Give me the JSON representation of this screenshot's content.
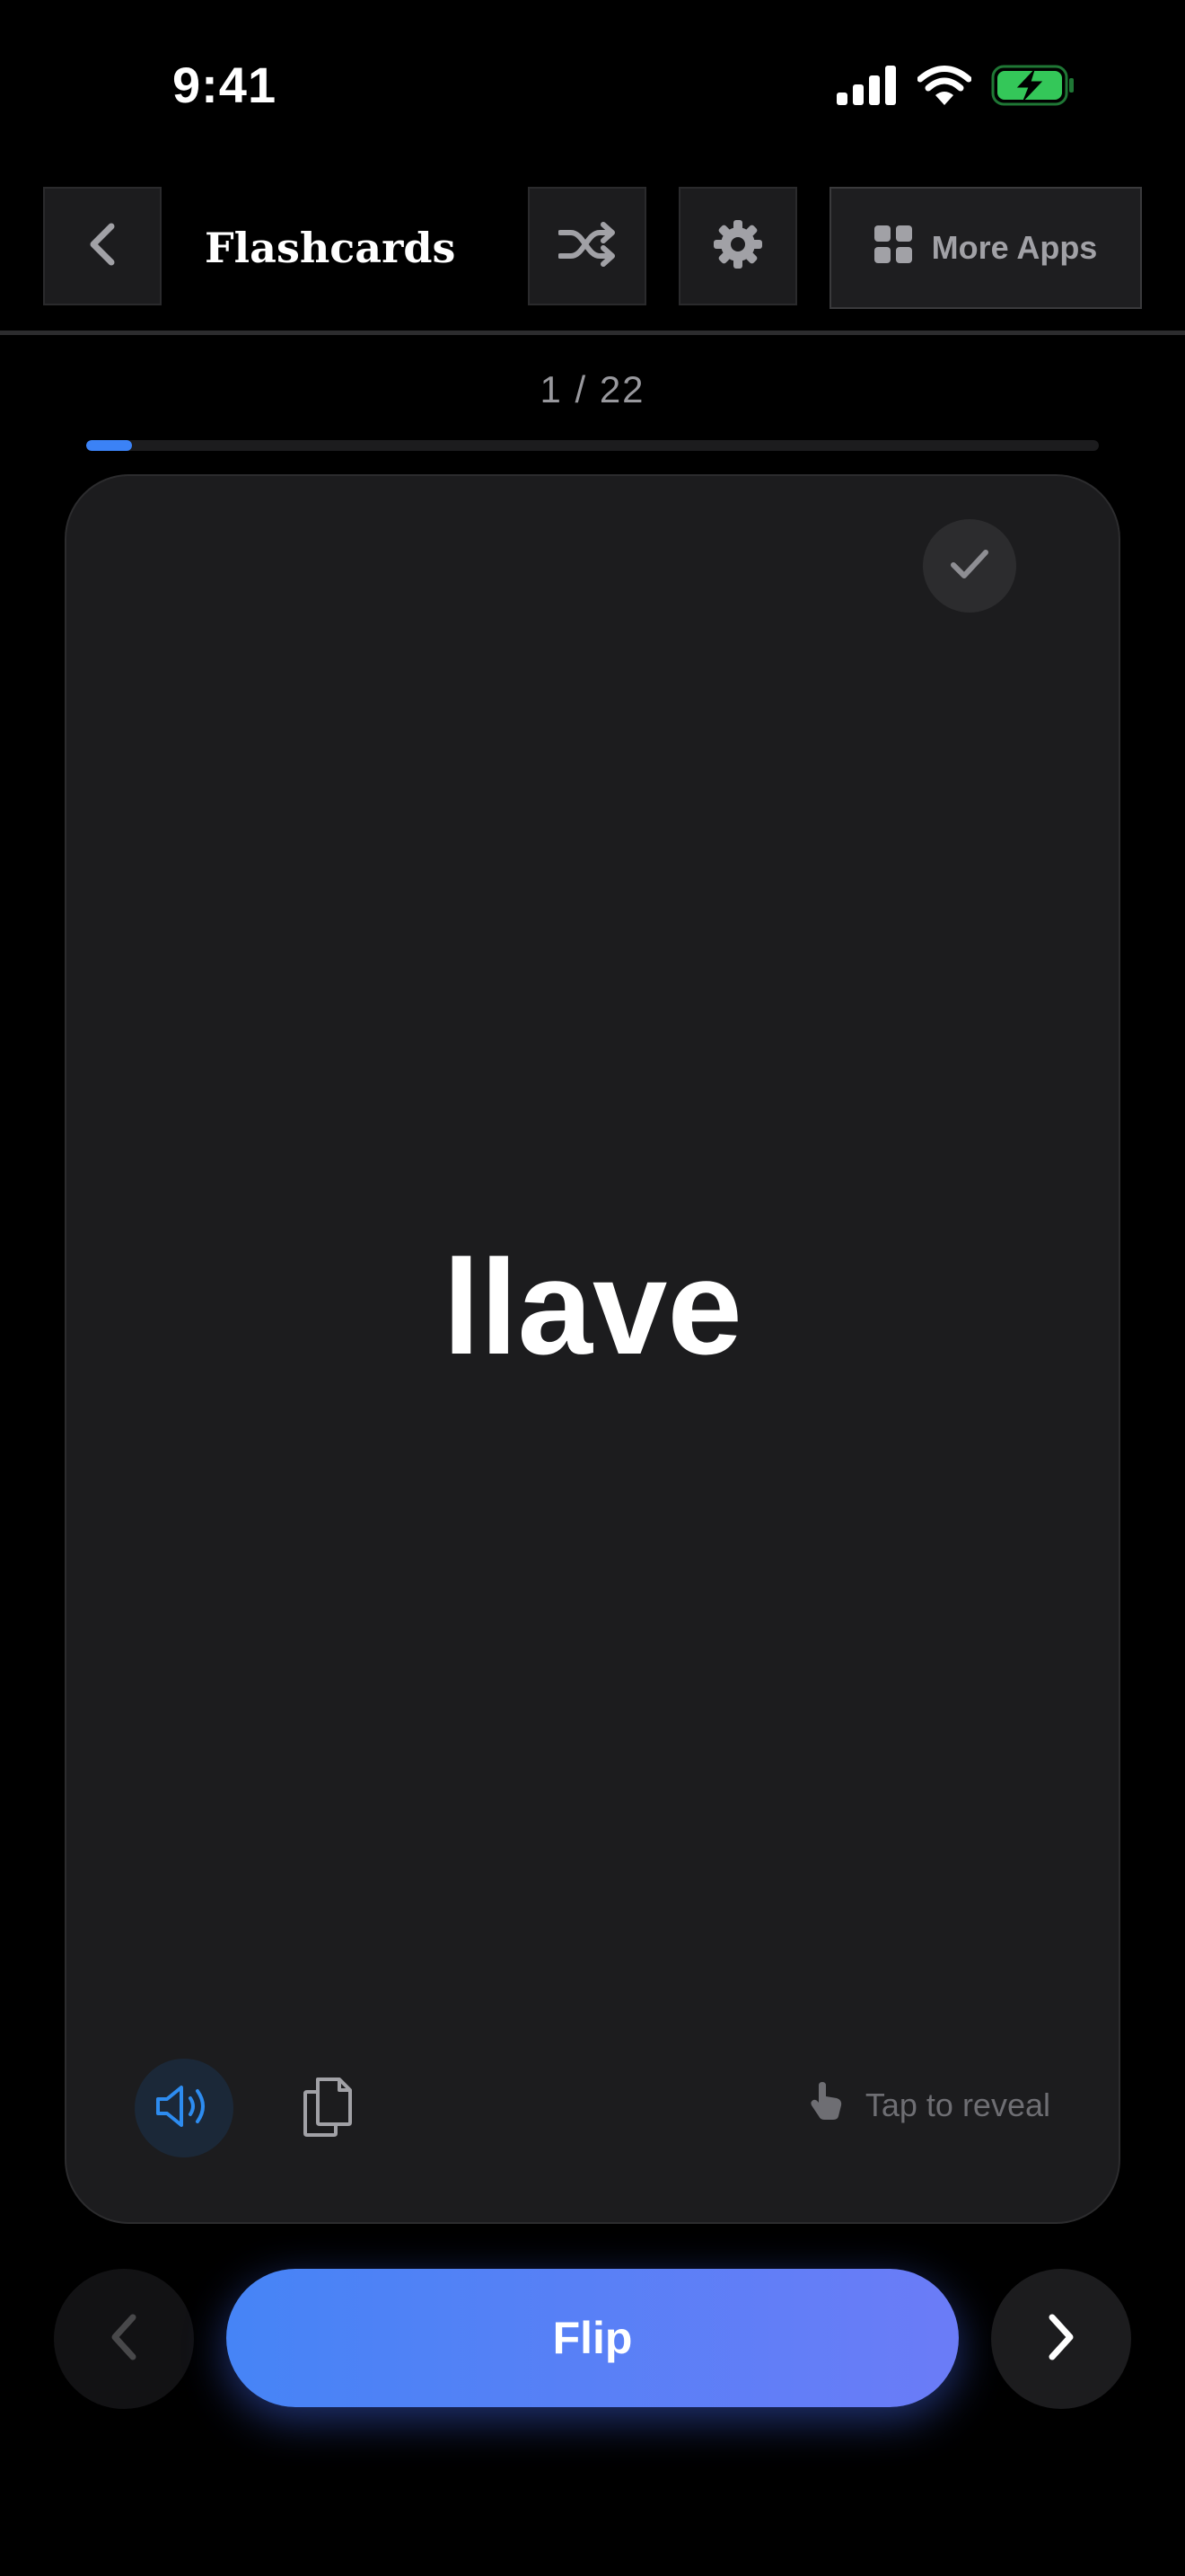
{
  "status_bar": {
    "time": "9:41",
    "icons": [
      "cellular-signal-icon",
      "wifi-icon",
      "battery-charging-icon"
    ],
    "battery_color": "#34c759"
  },
  "nav": {
    "title": "Flashcards",
    "back_icon": "chevron-left-icon",
    "shuffle_icon": "shuffle-icon",
    "settings_icon": "gear-icon",
    "more_apps_label": "More Apps",
    "more_apps_icon": "grid-icon"
  },
  "progress": {
    "label": "1 / 22",
    "current": 1,
    "total": 22,
    "fraction": 0.045,
    "color": "#3b82f6"
  },
  "card": {
    "word": "llave",
    "check_icon": "checkmark-icon",
    "speaker_icon": "speaker-icon",
    "copy_icon": "copy-icon",
    "hint_icon": "tap-hand-icon",
    "hint": "Tap to reveal"
  },
  "controls": {
    "flip_label": "Flip",
    "prev_icon": "chevron-left-icon",
    "next_icon": "chevron-right-icon",
    "accent_start": "#4684f6",
    "accent_end": "#6b7cf7"
  }
}
